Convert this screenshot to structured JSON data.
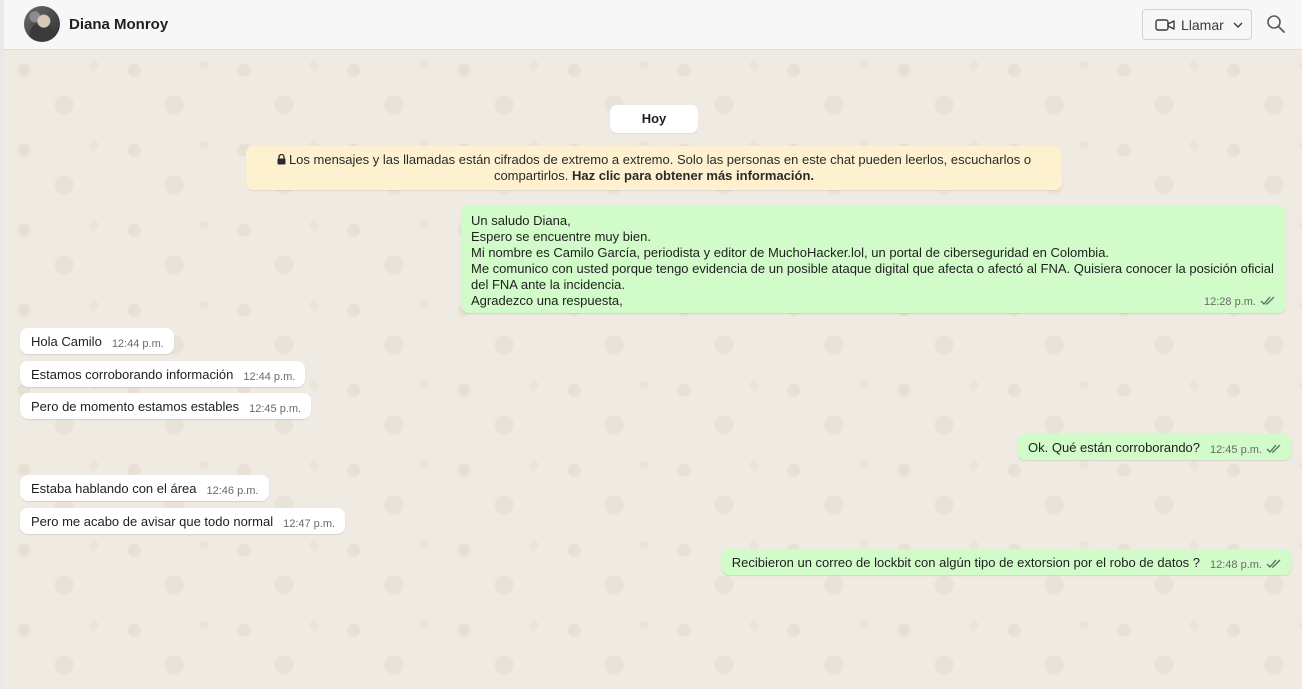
{
  "header": {
    "contact_name": "Diana Monroy",
    "call_label": "Llamar"
  },
  "chat": {
    "date_label": "Hoy",
    "encryption_notice": {
      "text": "Los mensajes y las llamadas están cifrados de extremo a extremo. Solo las personas en este chat pueden leerlos, escucharlos o compartirlos.",
      "link": "Haz clic para obtener más información."
    },
    "messages": [
      {
        "direction": "out",
        "text": "Un saludo Diana,\nEspero se encuentre muy bien.\nMi nombre es Camilo García, periodista y editor de MuchoHacker.lol, un portal de ciberseguridad en Colombia.\nMe comunico con usted porque tengo evidencia de un posible ataque digital que afecta o afectó al FNA. Quisiera conocer la posición oficial del FNA ante la incidencia.\nAgradezco una respuesta,",
        "time": "12:28 p.m."
      },
      {
        "direction": "in",
        "text": "Hola Camilo",
        "time": "12:44 p.m."
      },
      {
        "direction": "in",
        "text": "Estamos corroborando información",
        "time": "12:44 p.m."
      },
      {
        "direction": "in",
        "text": "Pero de momento estamos estables",
        "time": "12:45 p.m."
      },
      {
        "direction": "out",
        "text": "Ok. Qué están corroborando?",
        "time": "12:45 p.m."
      },
      {
        "direction": "in",
        "text": "Estaba hablando con el área",
        "time": "12:46 p.m."
      },
      {
        "direction": "in",
        "text": "Pero me acabo de avisar que todo normal",
        "time": "12:47 p.m."
      },
      {
        "direction": "out",
        "text": "Recibieron un correo de lockbit con algún tipo de extorsion por el robo de datos ?",
        "time": "12:48 p.m."
      }
    ]
  },
  "colors": {
    "outgoing_bubble": "#d1fbc9",
    "incoming_bubble": "#ffffff",
    "notice_bg": "#fdf1cf",
    "chat_bg": "#efeae2",
    "read_ticks": "#5b6b63"
  }
}
